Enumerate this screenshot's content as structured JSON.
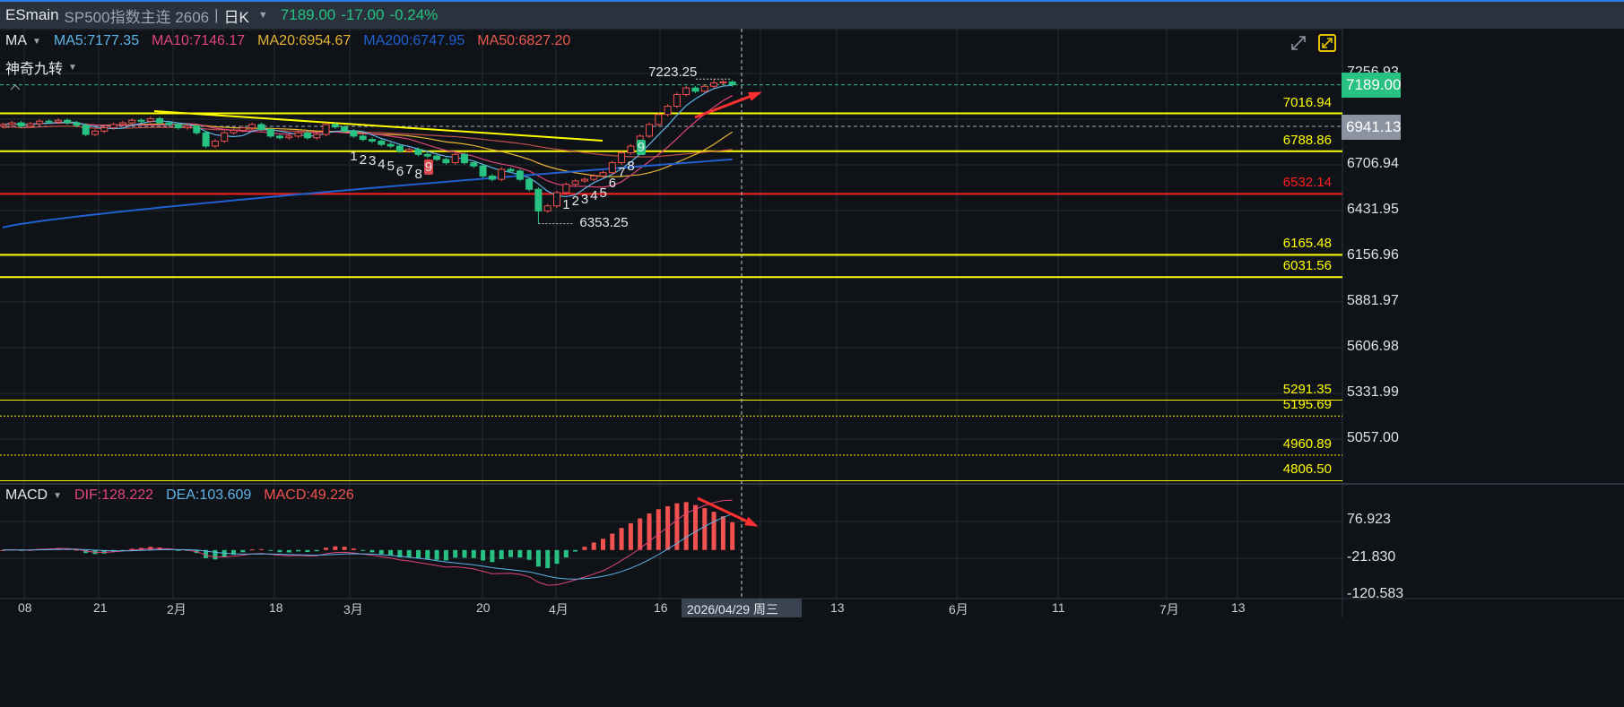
{
  "header": {
    "symbol": "ESmain",
    "name": "SP500指数主连 2606",
    "separator": "|",
    "period": "日K",
    "last": "7189.00",
    "change": "-17.00",
    "change_pct": "-0.24%"
  },
  "ma_legend": {
    "label": "MA",
    "items": [
      {
        "text": "MA5:7177.35",
        "color": "#5fb4e8"
      },
      {
        "text": "MA10:7146.17",
        "color": "#e0457b"
      },
      {
        "text": "MA20:6954.67",
        "color": "#e6b432"
      },
      {
        "text": "MA200:6747.95",
        "color": "#2060d0"
      },
      {
        "text": "MA50:6827.20",
        "color": "#e85a4f"
      }
    ]
  },
  "td_label": "神奇九转",
  "macd_legend": {
    "label": "MACD",
    "dif": "DIF:128.222",
    "dea": "DEA:103.609",
    "macd": "MACD:49.226"
  },
  "price_axis": [
    "7256.93",
    "6706.94",
    "6431.95",
    "6156.96",
    "5881.97",
    "5606.98",
    "5331.99",
    "5057.00"
  ],
  "price_axis_values": [
    7256.93,
    6706.94,
    6431.95,
    6156.96,
    5881.97,
    5606.98,
    5331.99,
    5057.0
  ],
  "price_tags": {
    "last": "7189.00",
    "cross": "6941.13",
    "last_color": "#27c281",
    "cross_color": "#8b93a1"
  },
  "macd_axis": [
    "76.923",
    "-21.830",
    "-120.583"
  ],
  "macd_axis_values": [
    76.923,
    -21.83,
    -120.583
  ],
  "x_labels": [
    "08",
    "21",
    "2月",
    "18",
    "3月",
    "20",
    "4月",
    "16",
    "13",
    "6月",
    "11",
    "7月",
    "13"
  ],
  "cursor_date": "2026/04/29 周三",
  "chart_data": {
    "type": "candlestick",
    "closes": [
      6950,
      6960,
      6940,
      6955,
      6970,
      6965,
      6975,
      6960,
      6945,
      6890,
      6910,
      6930,
      6950,
      6960,
      6975,
      6970,
      6985,
      6960,
      6950,
      6930,
      6940,
      6900,
      6820,
      6850,
      6900,
      6915,
      6930,
      6950,
      6920,
      6880,
      6870,
      6880,
      6900,
      6870,
      6890,
      6950,
      6935,
      6910,
      6880,
      6860,
      6850,
      6830,
      6820,
      6790,
      6800,
      6770,
      6760,
      6740,
      6720,
      6770,
      6720,
      6700,
      6640,
      6620,
      6680,
      6670,
      6620,
      6560,
      6430,
      6460,
      6540,
      6590,
      6610,
      6620,
      6640,
      6660,
      6720,
      6780,
      6820,
      6880,
      6950,
      7010,
      7060,
      7130,
      7170,
      7150,
      7180,
      7200,
      7206,
      7189
    ],
    "high_label": "7223.25",
    "high_value": 7223.25,
    "high_index": 77,
    "low_label": "6353.25",
    "low_value": 6353.25,
    "low_index": 58,
    "ma200_range": [
      6330,
      6740
    ],
    "levels": [
      {
        "value": 7016.94,
        "label": "7016.94",
        "color": "#ffff00"
      },
      {
        "value": 6788.86,
        "label": "6788.86",
        "color": "#ffff00"
      },
      {
        "value": 6532.14,
        "label": "6532.14",
        "color": "#ff2020"
      },
      {
        "value": 6165.48,
        "label": "6165.48",
        "color": "#ffff00"
      },
      {
        "value": 6031.56,
        "label": "6031.56",
        "color": "#ffff00"
      },
      {
        "value": 5291.35,
        "label": "5291.35",
        "color": "#ffff00"
      },
      {
        "value": 5195.69,
        "label": "5195.69",
        "color": "#ffff00"
      },
      {
        "value": 4960.89,
        "label": "4960.89",
        "color": "#ffff00"
      },
      {
        "value": 4806.5,
        "label": "4806.50",
        "color": "#ffff00"
      }
    ],
    "td_sequences": [
      {
        "start": 38,
        "labels": [
          "1",
          "2",
          "3",
          "4",
          "5",
          "6",
          "7",
          "8",
          "9"
        ]
      },
      {
        "start": 61,
        "labels": [
          "1",
          "2",
          "3",
          "4",
          "5",
          "6",
          "7",
          "8",
          "9"
        ]
      }
    ],
    "up_color": "#f0524f",
    "down_color": "#27c281"
  }
}
